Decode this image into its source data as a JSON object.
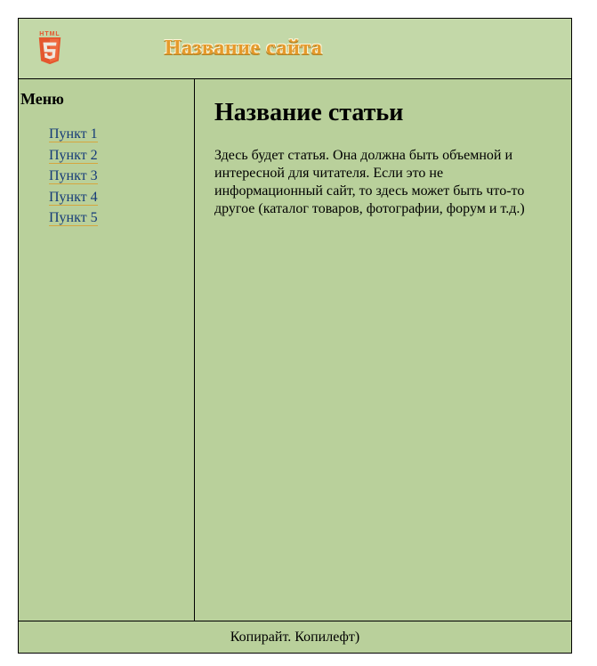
{
  "header": {
    "logo_text": "HTML",
    "site_title": "Название сайта"
  },
  "sidebar": {
    "menu_title": "Меню",
    "items": [
      {
        "label": "Пункт 1"
      },
      {
        "label": "Пункт 2"
      },
      {
        "label": "Пункт 3"
      },
      {
        "label": "Пункт 4"
      },
      {
        "label": "Пункт 5"
      }
    ]
  },
  "article": {
    "title": "Название статьи",
    "body": "Здесь будет статья. Она должна быть объемной и интересной для читателя. Если это не информационный сайт, то здесь может быть что-то другое (каталог товаров, фотографии, форум и т.д.)"
  },
  "footer": {
    "text": "Копирайт. Копилефт)"
  }
}
